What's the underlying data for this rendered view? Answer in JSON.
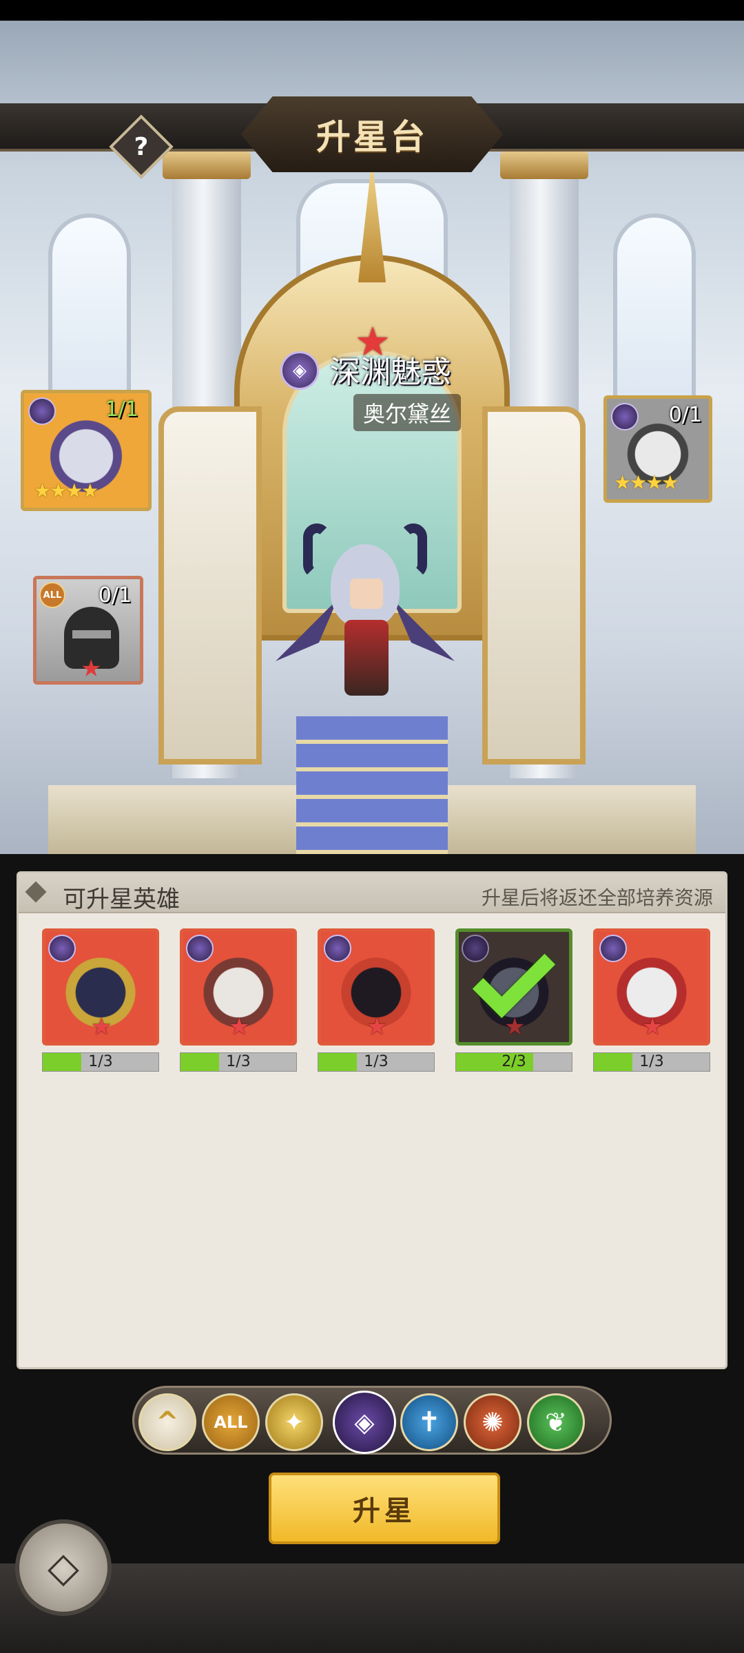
{
  "header": {
    "title": "升星台",
    "help_label": "?"
  },
  "target_hero": {
    "title": "深渊魅惑",
    "name": "奥尔黛丝",
    "faction_icon": "dark-faction-icon",
    "star_color": "#e53a3a"
  },
  "requirements": [
    {
      "id": "left",
      "count": "1/1",
      "stars": "★★★★"
    },
    {
      "id": "right",
      "count": "0/1",
      "stars": "★★★★"
    },
    {
      "id": "any",
      "count": "0/1",
      "badge": "ALL"
    }
  ],
  "panel": {
    "title": "可升星英雄",
    "note": "升星后将返还全部培养资源",
    "heroes": [
      {
        "progress": "1/3",
        "fill": 0.333,
        "selected": false
      },
      {
        "progress": "1/3",
        "fill": 0.333,
        "selected": false
      },
      {
        "progress": "1/3",
        "fill": 0.333,
        "selected": false
      },
      {
        "progress": "2/3",
        "fill": 0.667,
        "selected": true
      },
      {
        "progress": "1/3",
        "fill": 0.333,
        "selected": false
      }
    ]
  },
  "filters": {
    "collapse": "^",
    "all": "ALL",
    "light": "✦",
    "dark": "◈",
    "holy": "✝",
    "beast": "✺",
    "nature": "❦"
  },
  "actions": {
    "star_up": "升星",
    "back_icon": "◇"
  }
}
